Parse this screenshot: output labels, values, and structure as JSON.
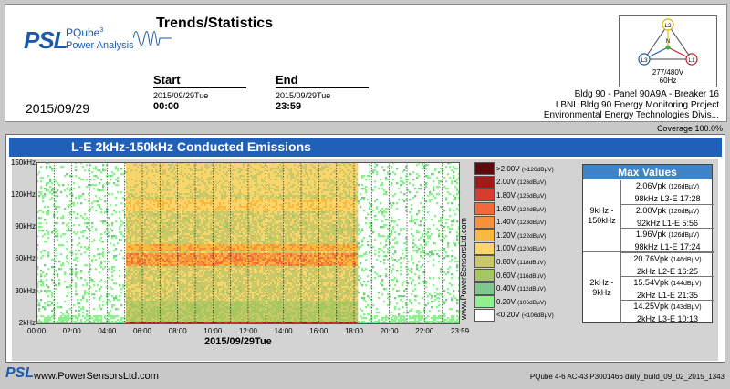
{
  "header": {
    "logo_text": "PSL",
    "logo_product": "PQube",
    "logo_product_sup": "3",
    "logo_subtitle": "Power Analysis",
    "page_title": "Trends/Statistics",
    "big_date": "2015/09/29",
    "start_label": "Start",
    "start_date": "2015/09/29Tue",
    "start_time": "00:00",
    "end_label": "End",
    "end_date": "2015/09/29Tue",
    "end_time": "23:59",
    "site_line1": "Bldg 90 - Panel 90A9A - Breaker 16",
    "site_line2": "LBNL Bldg 90 Energy Monitoring Project",
    "site_line3": "Environmental Energy Technologies Divis...",
    "phase_labels": {
      "l1": "L1",
      "l2": "L2",
      "l3": "L3",
      "n": "N"
    },
    "voltage": "277/480V",
    "frequency": "60Hz"
  },
  "coverage": "Coverage 100.0%",
  "panel": {
    "title": "L-E 2kHz-150kHz Conducted Emissions",
    "vertical_site": "www.PowerSensorsLtd.com"
  },
  "chart_data": {
    "type": "heatmap",
    "title": "L-E 2kHz-150kHz Conducted Emissions",
    "y_ticks": [
      "150kHz",
      "120kHz",
      "90kHz",
      "60kHz",
      "30kHz",
      "2kHz"
    ],
    "x_ticks": [
      "00:00",
      "02:00",
      "04:00",
      "06:00",
      "08:00",
      "10:00",
      "12:00",
      "14:00",
      "16:00",
      "18:00",
      "20:00",
      "22:00",
      "23:59"
    ],
    "x_axis_label": "2015/09/29Tue",
    "legend": [
      {
        "label": ">2.00V",
        "db": "(>126dBµV)",
        "color": "#5e0a0a"
      },
      {
        "label": "2.00V",
        "db": "(126dBµV)",
        "color": "#a11a1a"
      },
      {
        "label": "1.80V",
        "db": "(125dBµV)",
        "color": "#d63c30"
      },
      {
        "label": "1.60V",
        "db": "(124dBµV)",
        "color": "#f26a3a"
      },
      {
        "label": "1.40V",
        "db": "(123dBµV)",
        "color": "#f5913a"
      },
      {
        "label": "1.20V",
        "db": "(122dBµV)",
        "color": "#f8b93f"
      },
      {
        "label": "1.00V",
        "db": "(120dBµV)",
        "color": "#fad66a"
      },
      {
        "label": "0.80V",
        "db": "(118dBµV)",
        "color": "#c9c96a"
      },
      {
        "label": "0.60V",
        "db": "(116dBµV)",
        "color": "#a6c65e"
      },
      {
        "label": "0.40V",
        "db": "(112dBµV)",
        "color": "#7fc78a"
      },
      {
        "label": "0.20V",
        "db": "(106dBµV)",
        "color": "#8ef08e"
      },
      {
        "label": "<0.20V",
        "db": "(<106dBµV)",
        "color": "#ffffff"
      }
    ],
    "active_start_hour": 5,
    "active_end_hour": 18.2
  },
  "max_values": {
    "title": "Max Values",
    "groups": [
      {
        "band_line1": "9kHz -",
        "band_line2": "150kHz",
        "entries": [
          {
            "value": "2.06Vpk",
            "db": "(126dBµV)",
            "detail": "98kHz  L3-E  17:28"
          },
          {
            "value": "2.00Vpk",
            "db": "(126dBµV)",
            "detail": "92kHz  L1-E  5:56"
          },
          {
            "value": "1.96Vpk",
            "db": "(126dBµV)",
            "detail": "98kHz  L1-E  17:24"
          }
        ]
      },
      {
        "band_line1": "2kHz -",
        "band_line2": "9kHz",
        "entries": [
          {
            "value": "20.76Vpk",
            "db": "(146dBµV)",
            "detail": "2kHz  L2-E  16:25"
          },
          {
            "value": "15.54Vpk",
            "db": "(144dBµV)",
            "detail": "2kHz  L1-E  21:35"
          },
          {
            "value": "14.25Vpk",
            "db": "(143dBµV)",
            "detail": "2kHz  L3-E  10:13"
          }
        ]
      }
    ]
  },
  "footer": {
    "logo": "PSL",
    "site": "www.PowerSensorsLtd.com",
    "build": "PQube 4-6 AC-43   P3001466  daily_build_09_02_2015_1343"
  }
}
